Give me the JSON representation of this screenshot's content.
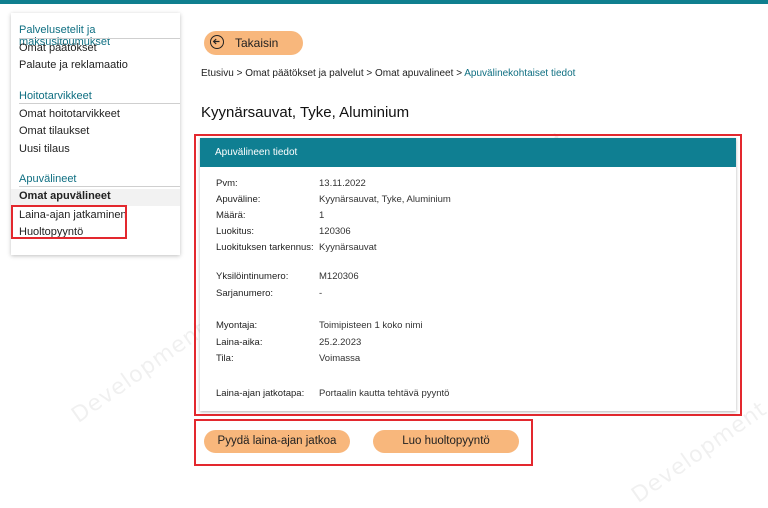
{
  "sidebar": {
    "sections": [
      {
        "title": "Palvelusetelit ja maksusitoumukset",
        "items": [
          "Omat päätökset",
          "Palaute ja reklamaatio"
        ]
      },
      {
        "title": "Hoitotarvikkeet",
        "items": [
          "Omat hoitotarvikkeet",
          "Omat tilaukset",
          "Uusi tilaus"
        ]
      },
      {
        "title": "Apuvälineet",
        "items": [
          "Omat apuvälineet",
          "Laina-ajan jatkaminen",
          "Huoltopyyntö"
        ]
      }
    ]
  },
  "back_button": {
    "label": "Takaisin",
    "icon": "arrow-left-circle-icon"
  },
  "breadcrumb": {
    "items": [
      "Etusivu",
      "Omat päätökset ja palvelut",
      "Omat apuvalineet"
    ],
    "separator": ">",
    "current": "Apuvälinekohtaiset tiedot"
  },
  "page_title": "Kyynärsauvat, Tyke, Aluminium",
  "card": {
    "header": "Apuvälineen tiedot",
    "fields": [
      {
        "label": "Pvm:",
        "value": "13.11.2022"
      },
      {
        "label": "Apuväline:",
        "value": "Kyynärsauvat, Tyke, Aluminium"
      },
      {
        "label": "Määrä:",
        "value": "1"
      },
      {
        "label": "Luokitus:",
        "value": "120306"
      },
      {
        "label": "Luokituksen tarkennus:",
        "value": "Kyynärsauvat"
      },
      {
        "label": "Yksilöintinumero:",
        "value": "M120306"
      },
      {
        "label": "Sarjanumero:",
        "value": "-"
      },
      {
        "label": "Myontaja:",
        "value": "Toimipisteen 1 koko nimi"
      },
      {
        "label": "Laina-aika:",
        "value": "25.2.2023"
      },
      {
        "label": "Tila:",
        "value": "Voimassa"
      },
      {
        "label": "Laina-ajan jatkotapa:",
        "value": "Portaalin kautta tehtävä pyyntö"
      }
    ]
  },
  "actions": {
    "extend_label": "Pyydä laina-ajan jatkoa",
    "service_label": "Luo huoltopyyntö"
  },
  "watermark": "Development",
  "colors": {
    "accent": "#0f7f92",
    "link": "#0f6f82",
    "button": "#f8b77c",
    "highlight_box": "#e3282e"
  }
}
